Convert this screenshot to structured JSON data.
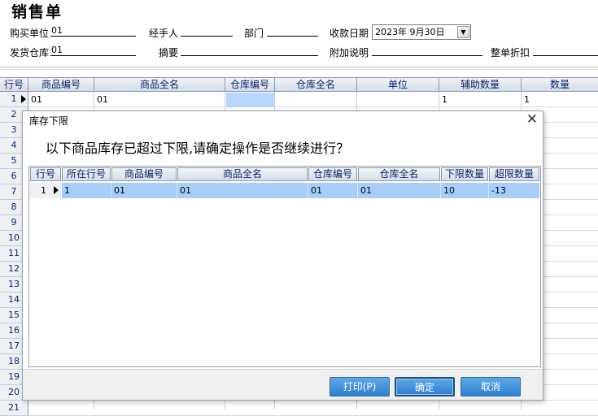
{
  "form": {
    "title": "销售单",
    "buyer_label": "购买单位",
    "buyer_value": "01",
    "handler_label": "经手人",
    "handler_value": "",
    "dept_label": "部门",
    "dept_value": "",
    "date_label": "收款日期",
    "date_value": "2023年  9月30日",
    "warehouse_label": "发货仓库",
    "warehouse_value": "01",
    "summary_label": "摘要",
    "summary_value": "",
    "note_label": "附加说明",
    "note_value": "",
    "discount_label": "整单折扣",
    "discount_value": ""
  },
  "grid": {
    "headers": [
      "行号",
      "商品编号",
      "商品全名",
      "仓库编号",
      "仓库全名",
      "单位",
      "辅助数量",
      "数量"
    ],
    "row_numbers": [
      "1",
      "2",
      "3",
      "4",
      "5",
      "6",
      "7",
      "8",
      "9",
      "10",
      "11",
      "12",
      "13",
      "14",
      "15",
      "16",
      "17",
      "18",
      "19",
      "20",
      "21"
    ],
    "row1": {
      "product_code": "01",
      "product_name": "01",
      "warehouse_code": "",
      "warehouse_name": "",
      "unit": "",
      "aux_qty": "1",
      "qty": "1"
    }
  },
  "dialog": {
    "title": "库存下限",
    "close_glyph": "✕",
    "message": "以下商品库存已超过下限,请确定操作是否继续进行？",
    "headers": [
      "行号",
      "所在行号",
      "商品编号",
      "商品全名",
      "仓库编号",
      "仓库全名",
      "下限数量",
      "超限数量"
    ],
    "row": {
      "num": "1",
      "line": "1",
      "product_code": "01",
      "product_name": "01",
      "warehouse_code": "01",
      "warehouse_name": "01",
      "min_qty": "10",
      "over_qty": "-13"
    },
    "buttons": {
      "print": "打印(P)",
      "ok": "确定",
      "cancel": "取消"
    }
  },
  "colors": {
    "header_text": "#0a246a",
    "selection": "#a7cdf8",
    "button": "#2e80d0"
  }
}
